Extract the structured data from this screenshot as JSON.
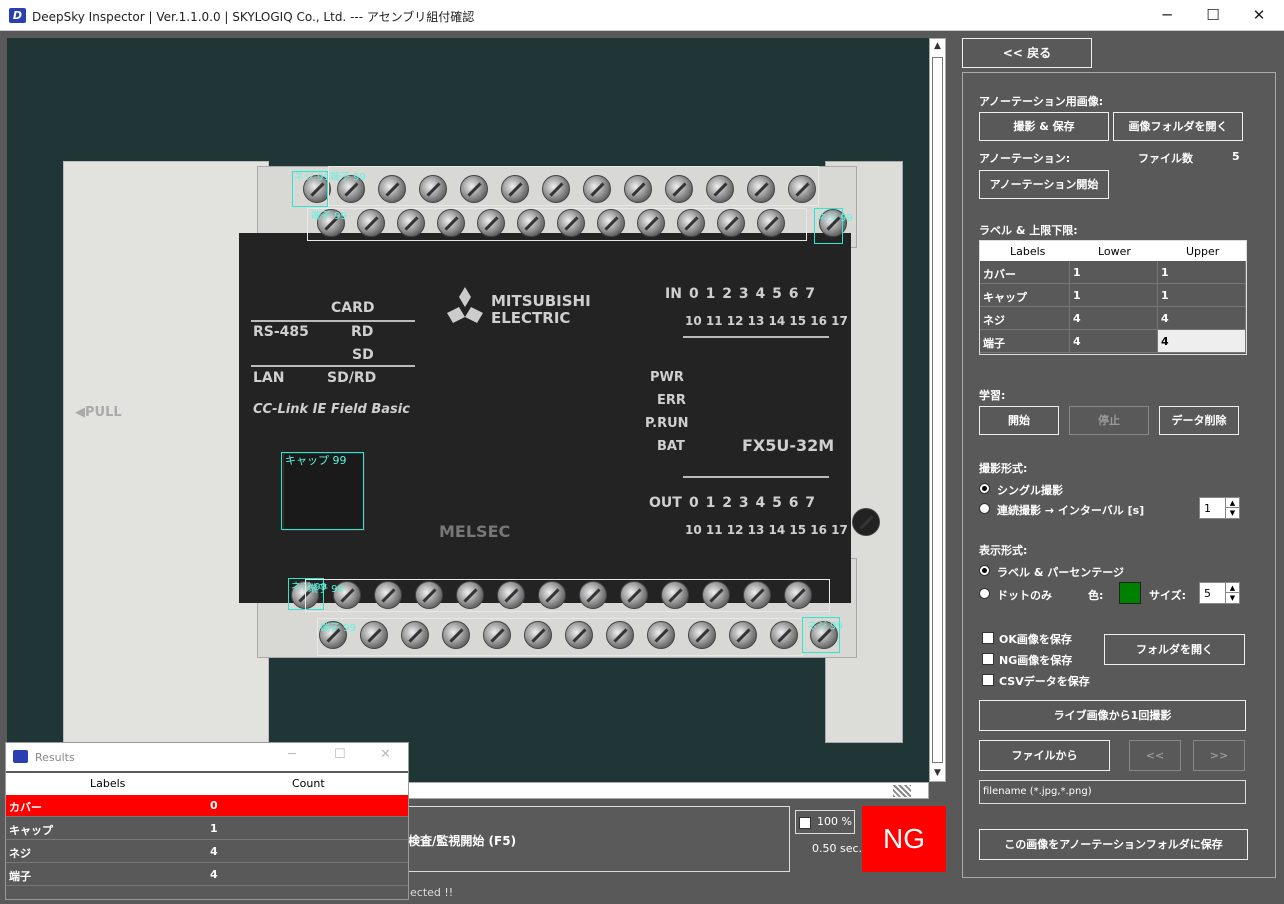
{
  "window": {
    "title": "DeepSky Inspector | Ver.1.1.0.0 | SKYLOGIQ Co., Ltd. --- アセンブリ組付確認",
    "minimize": "─",
    "maximize": "☐",
    "close": "✕"
  },
  "device": {
    "pull": "◀PULL",
    "card": "CARD",
    "rs485": "RS-485",
    "rd": "RD",
    "sd": "SD",
    "lan": "LAN",
    "sdrd": "SD/RD",
    "cclink": "CC-Link IE Field Basic",
    "brand1": "MITSUBISHI",
    "brand2": "ELECTRIC",
    "in_label": "IN",
    "out_label": "OUT",
    "io_row1": "0 1 2 3 4 5 6 7",
    "io_row2": "10 11 12 13 14 15 16 17",
    "pwr": "PWR",
    "err": "ERR",
    "prun": "P.RUN",
    "bat": "BAT",
    "model": "FX5U-32M",
    "melsec": "MELSEC"
  },
  "detections": {
    "neji": "ネジ 99",
    "tanshi": "端子 99",
    "cap": "キャップ 99"
  },
  "results": {
    "title": "Results",
    "col_labels": "Labels",
    "col_count": "Count",
    "rows": [
      {
        "label": "カバー",
        "count": "0",
        "highlight": true
      },
      {
        "label": "キャップ",
        "count": "1",
        "highlight": false
      },
      {
        "label": "ネジ",
        "count": "4",
        "highlight": false
      },
      {
        "label": "端子",
        "count": "4",
        "highlight": false
      }
    ]
  },
  "bottom": {
    "start_label": "検査/監視開始 (F5)",
    "percent": "100 %",
    "seconds": "0.50 sec.",
    "verdict": "NG",
    "status": "ected !!"
  },
  "panel": {
    "back": "<< 戻る",
    "annotation_image": "アノーテーション用画像:",
    "capture_save": "撮影 & 保存",
    "open_image_folder": "画像フォルダを開く",
    "annotation": "アノーテーション:",
    "file_count_label": "ファイル数",
    "file_count": "5",
    "start_annotation": "アノーテーション開始",
    "label_limits": "ラベル & 上限下限:",
    "grid_headers": [
      "Labels",
      "Lower",
      "Upper"
    ],
    "grid_rows": [
      [
        "カバー",
        "1",
        "1"
      ],
      [
        "キャップ",
        "1",
        "1"
      ],
      [
        "ネジ",
        "4",
        "4"
      ],
      [
        "端子",
        "4",
        "4"
      ]
    ],
    "learning": "学習:",
    "learn_start": "開始",
    "learn_stop": "停止",
    "delete_data": "データ削除",
    "capture_mode": "撮影形式:",
    "single": "シングル撮影",
    "continuous": "連続撮影 → インターバル [s]",
    "interval": "1",
    "display_mode": "表示形式:",
    "label_percent": "ラベル & パーセンテージ",
    "dots_only": "ドットのみ",
    "color_label": "色:",
    "dot_color": "#008000",
    "size_label": "サイズ:",
    "size": "5",
    "save_ok": "OK画像を保存",
    "save_ng": "NG画像を保存",
    "save_csv": "CSVデータを保存",
    "open_folder": "フォルダを開く",
    "live_capture": "ライブ画像から1回撮影",
    "from_file": "ファイルから",
    "prev": "<<",
    "next": ">>",
    "filename_placeholder": "filename (*.jpg,*.png)",
    "save_to_annotation": "この画像をアノーテーションフォルダに保存"
  }
}
